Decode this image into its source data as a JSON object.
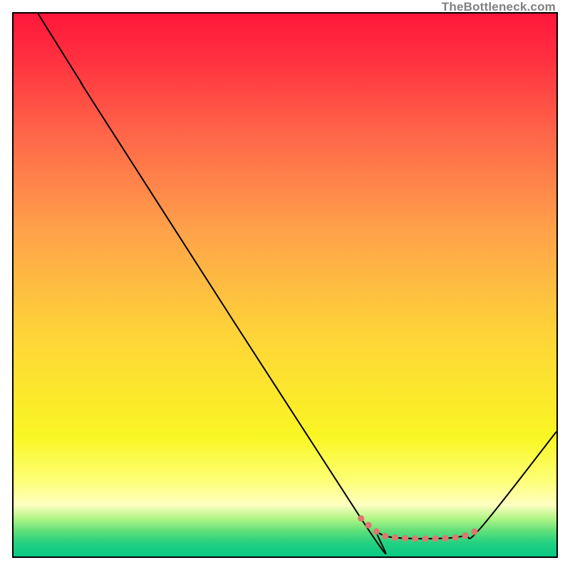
{
  "watermark": "TheBottleneck.com",
  "chart_data": {
    "type": "line",
    "title": "",
    "xlabel": "",
    "ylabel": "",
    "xlim": [
      0,
      100
    ],
    "ylim": [
      0,
      100
    ],
    "grid": false,
    "legend": false,
    "series": [
      {
        "name": "black-curve",
        "stroke": "#000000",
        "points": [
          {
            "x": 4.5,
            "y": 100
          },
          {
            "x": 12,
            "y": 88
          },
          {
            "x": 18,
            "y": 78.5
          },
          {
            "x": 64,
            "y": 7
          },
          {
            "x": 67,
            "y": 4.5
          },
          {
            "x": 70,
            "y": 3.5
          },
          {
            "x": 78,
            "y": 3.3
          },
          {
            "x": 83,
            "y": 3.8
          },
          {
            "x": 86,
            "y": 5.2
          },
          {
            "x": 100,
            "y": 23
          }
        ]
      },
      {
        "name": "red-dotted-valley",
        "stroke": "#E0766F",
        "style": "dotted",
        "points": [
          {
            "x": 64,
            "y": 7
          },
          {
            "x": 67,
            "y": 4.5
          },
          {
            "x": 70,
            "y": 3.5
          },
          {
            "x": 78,
            "y": 3.3
          },
          {
            "x": 83,
            "y": 3.8
          },
          {
            "x": 86,
            "y": 5.2
          }
        ]
      }
    ],
    "background_gradient": {
      "type": "vertical",
      "stops": [
        {
          "pos": 0.0,
          "color": "#FF173B"
        },
        {
          "pos": 0.08,
          "color": "#FF2F3F"
        },
        {
          "pos": 0.22,
          "color": "#FF6549"
        },
        {
          "pos": 0.4,
          "color": "#FFA24A"
        },
        {
          "pos": 0.6,
          "color": "#FED637"
        },
        {
          "pos": 0.78,
          "color": "#F9F623"
        },
        {
          "pos": 0.86,
          "color": "#FEFF76"
        },
        {
          "pos": 0.905,
          "color": "#FFFFC1"
        },
        {
          "pos": 0.93,
          "color": "#B1F586"
        },
        {
          "pos": 0.955,
          "color": "#59DE79"
        },
        {
          "pos": 0.975,
          "color": "#24D181"
        },
        {
          "pos": 1.0,
          "color": "#06C983"
        }
      ]
    }
  }
}
